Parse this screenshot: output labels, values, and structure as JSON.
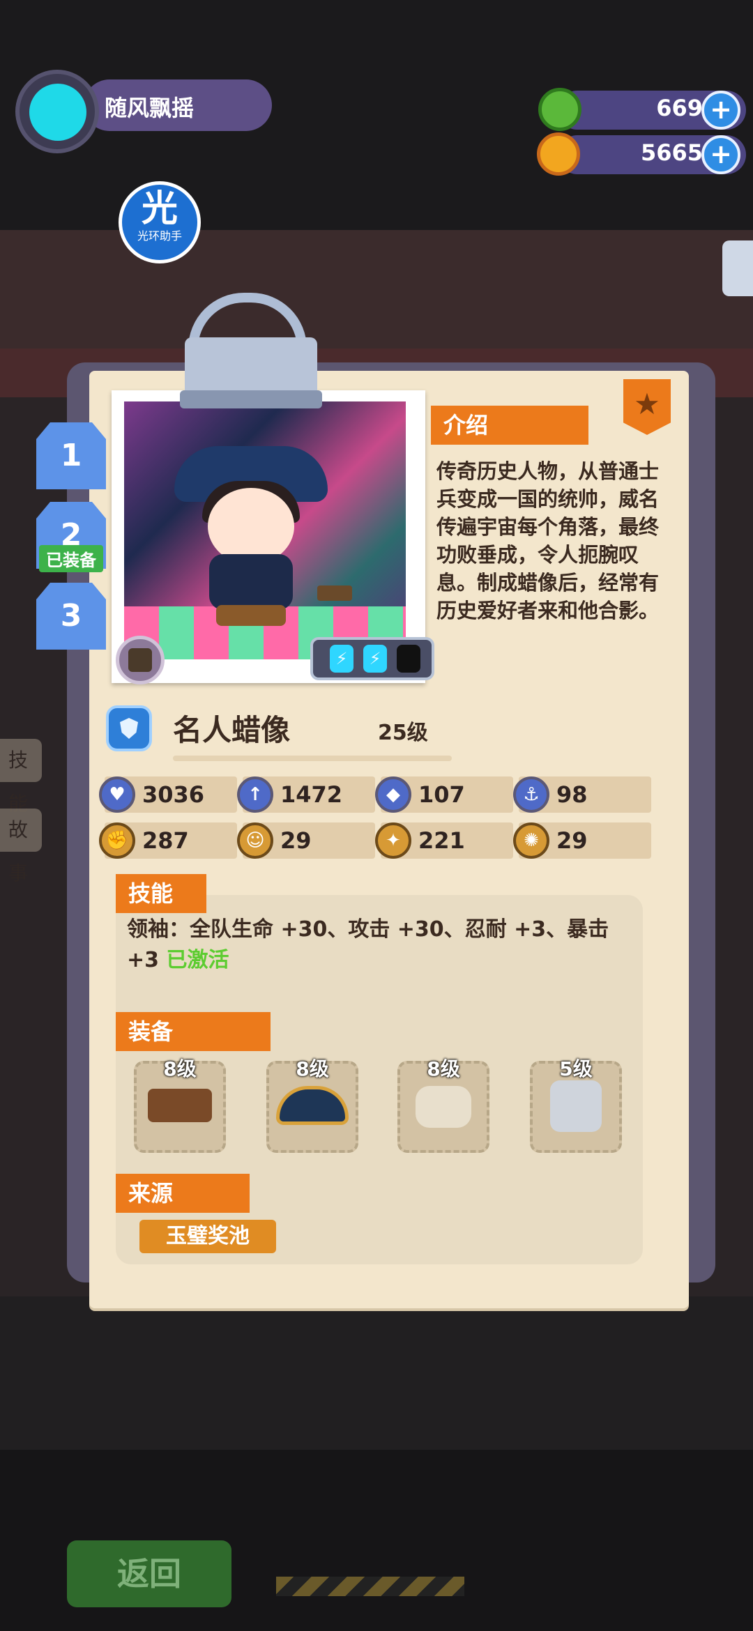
{
  "player": {
    "name": "随风飘摇"
  },
  "resources": [
    {
      "name": "donut-currency",
      "value": "669",
      "color": "#5bb83a"
    },
    {
      "name": "planet-currency",
      "value": "5665",
      "color": "#f2a61f"
    }
  ],
  "helper": {
    "glyph": "光",
    "label": "光环助手"
  },
  "outfit_tabs": [
    {
      "number": "1"
    },
    {
      "number": "2",
      "badge": "已装备"
    },
    {
      "number": "3"
    }
  ],
  "left_side_tabs": [
    "技能",
    "故事"
  ],
  "intro": {
    "title": "介绍",
    "text": "传奇历史人物，从普通士兵变成一国的统帅，威名传遍宇宙每个角落，最终功败垂成，令人扼腕叹息。制成蜡像后，经常有历史爱好者来和他合影。"
  },
  "card": {
    "name": "名人蜡像",
    "level": "25级",
    "energy_full": 2,
    "energy_total": 3
  },
  "stats": [
    {
      "icon": "heart-icon",
      "value": "3036"
    },
    {
      "icon": "sword-icon",
      "value": "1472"
    },
    {
      "icon": "shield-icon",
      "value": "107"
    },
    {
      "icon": "anchor-icon",
      "value": "98"
    },
    {
      "icon": "fist-icon",
      "value": "287"
    },
    {
      "icon": "smile-icon",
      "value": "29"
    },
    {
      "icon": "muscle-icon",
      "value": "221"
    },
    {
      "icon": "brain-icon",
      "value": "29"
    }
  ],
  "skill": {
    "title": "技能",
    "text": "领袖：全队生命 +30、攻击 +30、忍耐 +3、暴击 +3",
    "status": "已激活"
  },
  "equipment": {
    "title": "装备",
    "items": [
      {
        "name": "pistol-item",
        "level": "8级"
      },
      {
        "name": "bicorne-hat-item",
        "level": "8级"
      },
      {
        "name": "pants-item",
        "level": "8级"
      },
      {
        "name": "vest-item",
        "level": "5级"
      }
    ]
  },
  "source": {
    "title": "来源",
    "value": "玉璧奖池"
  },
  "bottom": {
    "return_label": "返回"
  }
}
